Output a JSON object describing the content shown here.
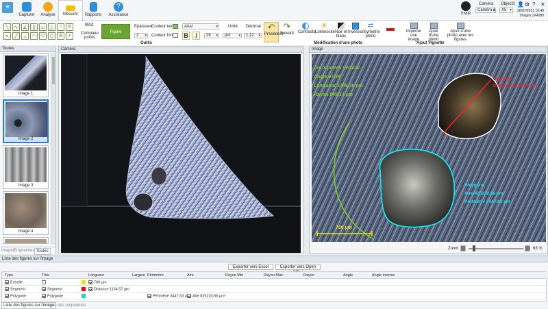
{
  "ribbon": {
    "tabs": [
      {
        "label": "Capturer"
      },
      {
        "label": "Analyse"
      },
      {
        "label": "Mesurer",
        "active": true
      },
      {
        "label": "Rapports"
      },
      {
        "label": "Assistance"
      }
    ],
    "compteur_label": "Compteur points",
    "raz_label": "RAZ",
    "figure_composee_label": "Figure Composée",
    "epaisseur_label": "Epaisseur",
    "epaisseur_value": "2",
    "couleur_texte_label": "Couleur texte",
    "couleur_fond_label": "Couleur fond",
    "font_value": "Arial",
    "font_size_value": "28",
    "unite_label": "Unité",
    "unite_value": "µm",
    "decimal_label": "Décimal",
    "decimal_value": "1,12",
    "bold_label": "B",
    "italic_label": "I",
    "outils_label": "Outils",
    "precedent_label": "Précédent",
    "suivant_label": "Suivant",
    "contraste_label": "Contraste",
    "luminosite_label": "Luminosité",
    "noir_blanc_label": "Noir et blanc",
    "inversion_label": "Inversion",
    "symetrie_label": "Symétrie photo",
    "modif_photo_label": "Modification d'une photo",
    "importer_label": "Importer une image",
    "ajout_photo_label": "Ajout d'une photo",
    "ajout_figures_label": "Ajout d'une photo avec les figures",
    "ajout_vignette_label": "Ajout Vignette",
    "user_label": "Invité",
    "camera_label": "Caméra",
    "camera_value": "Caméra 1",
    "objectif_label": "Objectif",
    "objectif_value": "X5",
    "datetime": "28/07/2021 10:48",
    "image_size": "Images 2X4280"
  },
  "left_panel": {
    "header": "Toutes",
    "thumbs": [
      {
        "caption": "Image 1"
      },
      {
        "caption": "Image 2",
        "selected": true
      },
      {
        "caption": "Image 3"
      },
      {
        "caption": "Image 4"
      }
    ],
    "tabs": [
      {
        "label": "Images"
      },
      {
        "label": "Empreintes"
      },
      {
        "label": "Toutes",
        "active": true
      }
    ]
  },
  "camera_panel": {
    "header": "Caméra"
  },
  "image_panel": {
    "header": "Image",
    "arc_label": "Arc 3 points vertical",
    "arc_angle": "Angle 97,59 °",
    "arc_length": "Longueur 1446,36 µm",
    "arc_radius": "Rayon 849,14 µm",
    "segment_label": "Segment",
    "segment_distance": "Distance 1134,57 µm",
    "polygone_label": "Polygone",
    "polygone_area": "Aire 825220,56 µm²",
    "polygone_perimeter": "Périmètre 3447,63 µm",
    "scale_label": "700 µm",
    "zoom_label": "Zoom",
    "zoom_value": "63 %",
    "zoom_level": 0.63
  },
  "figures": {
    "header": "Liste des figures sur l'image",
    "export_excel": "Exporter vers Excel",
    "export_openoffice": "Exporter vers Open Office",
    "columns": [
      "Type",
      "Titre",
      "",
      "Longueur",
      "Largeur",
      "Périmètre",
      "Aire",
      "Rayon Min",
      "Rayon Max",
      "Rayon",
      "Angle",
      "Angle inverse"
    ],
    "rows": [
      {
        "type": "Echelle",
        "titre": "",
        "color": "#f5e400",
        "longueur": "700 µm",
        "perimetre": "",
        "aire": ""
      },
      {
        "type": "Segment",
        "titre": "Segment",
        "color": "#e01010",
        "longueur": "Distance 1134,57 µm",
        "perimetre": "",
        "aire": ""
      },
      {
        "type": "Polygone",
        "titre": "Polygone",
        "color": "#19d3df",
        "longueur": "",
        "perimetre": "Périmètre 3447,63 µm",
        "aire": "Aire 825220,56 µm²"
      }
    ],
    "bottom_tabs": [
      {
        "label": "Liste des figures sur l'image",
        "active": true
      },
      {
        "label": "Liste des empreintes"
      }
    ]
  }
}
